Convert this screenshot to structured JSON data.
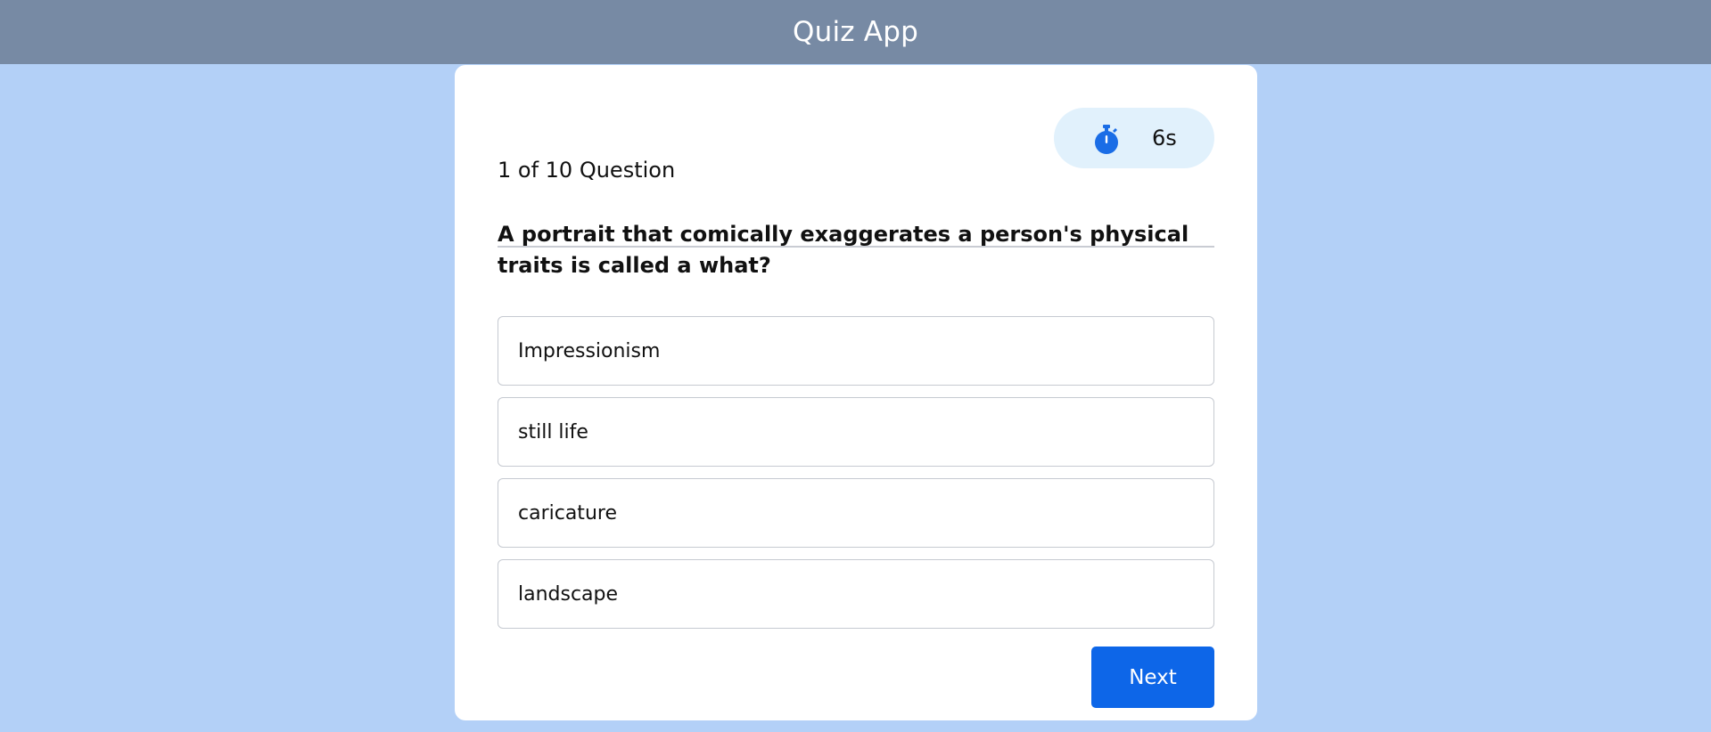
{
  "app": {
    "title": "Quiz App"
  },
  "quiz": {
    "counter": "1 of 10 Question",
    "timer": {
      "icon": "stopwatch-icon",
      "value": "6s"
    },
    "question": "A portrait that comically exaggerates a person's physical traits is called a what?",
    "options": [
      {
        "label": "Impressionism"
      },
      {
        "label": "still life"
      },
      {
        "label": "caricature"
      },
      {
        "label": "landscape"
      }
    ],
    "next_label": "Next"
  },
  "colors": {
    "background": "#b3d0f7",
    "header": "#778aa4",
    "card": "#ffffff",
    "timer_pill": "#e1f1fc",
    "timer_icon": "#1a6de6",
    "accent": "#0d66e8"
  }
}
